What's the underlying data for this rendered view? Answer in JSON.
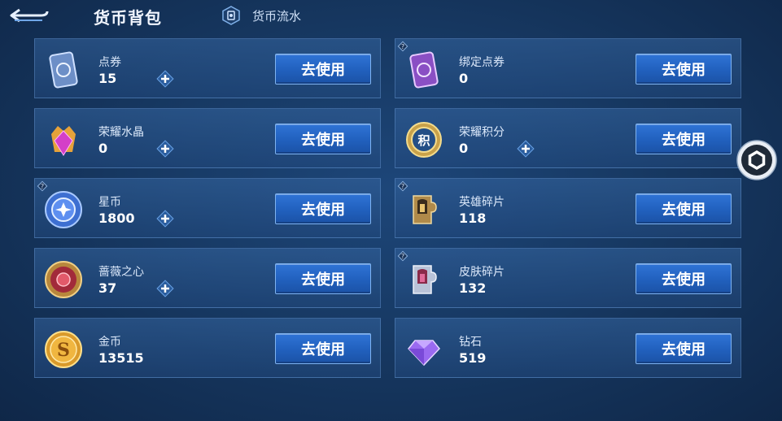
{
  "header": {
    "back_icon": "back-arrow-icon",
    "title": "货币背包",
    "flow_tab_label": "货币流水",
    "flow_tab_icon": "currency-flow-icon"
  },
  "use_label": "去使用",
  "items": [
    {
      "name": "点券",
      "value": "15",
      "icon": "coupon-icon",
      "has_plus": true,
      "has_help": false
    },
    {
      "name": "绑定点券",
      "value": "0",
      "icon": "bound-coupon-icon",
      "has_plus": false,
      "has_help": true
    },
    {
      "name": "荣耀水晶",
      "value": "0",
      "icon": "glory-crystal-icon",
      "has_plus": true,
      "has_help": false
    },
    {
      "name": "荣耀积分",
      "value": "0",
      "icon": "glory-points-icon",
      "has_plus": true,
      "has_help": false
    },
    {
      "name": "星币",
      "value": "1800",
      "icon": "star-coin-icon",
      "has_plus": true,
      "has_help": true
    },
    {
      "name": "英雄碎片",
      "value": "118",
      "icon": "hero-fragment-icon",
      "has_plus": false,
      "has_help": true
    },
    {
      "name": "蔷薇之心",
      "value": "37",
      "icon": "rose-heart-icon",
      "has_plus": true,
      "has_help": false
    },
    {
      "name": "皮肤碎片",
      "value": "132",
      "icon": "skin-fragment-icon",
      "has_plus": false,
      "has_help": true
    },
    {
      "name": "金币",
      "value": "13515",
      "icon": "gold-coin-icon",
      "has_plus": false,
      "has_help": false
    },
    {
      "name": "钻石",
      "value": "519",
      "icon": "diamond-icon",
      "has_plus": false,
      "has_help": false
    }
  ],
  "float_button_icon": "hexagon-menu-icon",
  "colors": {
    "accent": "#2a6bd0",
    "card_border": "#78aae6"
  }
}
